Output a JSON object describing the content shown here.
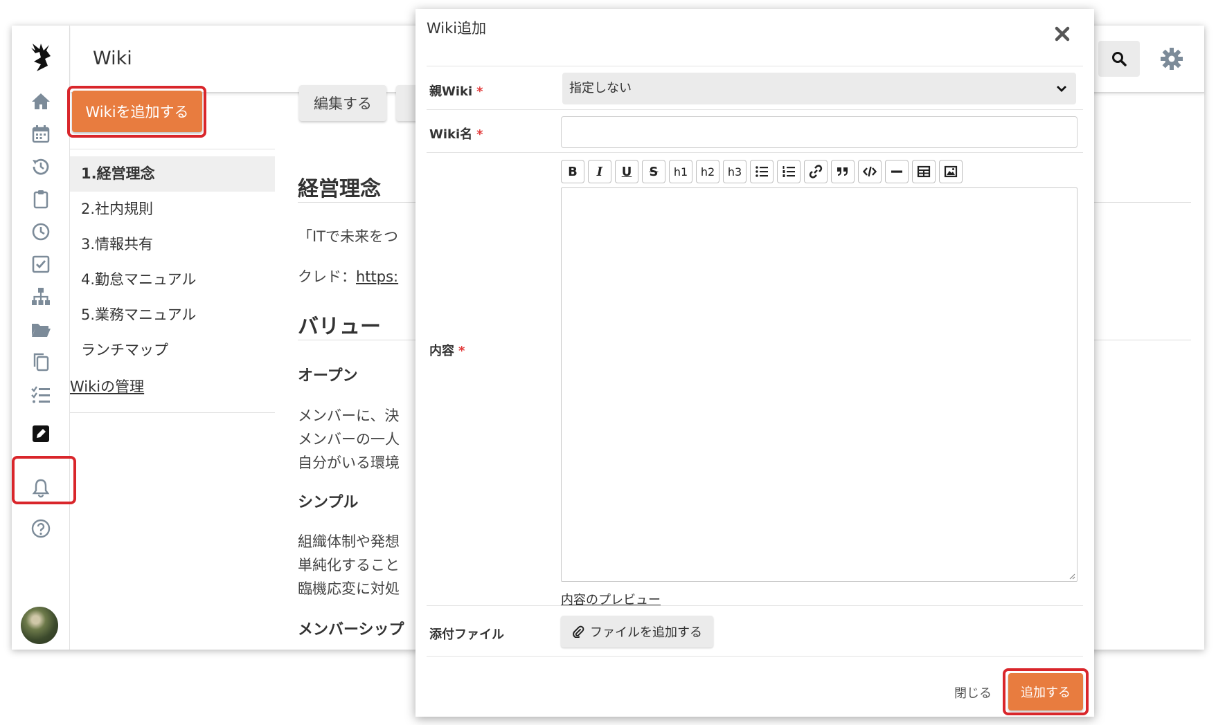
{
  "topbar": {
    "title": "Wiki",
    "search_icon": "search-icon",
    "settings_icon": "gear-icon"
  },
  "sidebar": {
    "items": [
      {
        "name": "home-icon"
      },
      {
        "name": "calendar-icon"
      },
      {
        "name": "history-icon"
      },
      {
        "name": "clipboard-icon"
      },
      {
        "name": "clock-icon"
      },
      {
        "name": "checkbox-icon"
      },
      {
        "name": "org-chart-icon"
      },
      {
        "name": "folder-open-icon"
      },
      {
        "name": "copy-icon"
      },
      {
        "name": "checklist-icon"
      },
      {
        "name": "edit-square-icon",
        "active": true
      },
      {
        "name": "bell-icon"
      },
      {
        "name": "help-circle-icon"
      }
    ]
  },
  "left_panel": {
    "add_wiki_label": "Wikiを追加する",
    "nav": [
      {
        "label": "1.経営理念",
        "active": true
      },
      {
        "label": "2.社内規則"
      },
      {
        "label": "3.情報共有"
      },
      {
        "label": "4.勤怠マニュアル"
      },
      {
        "label": "5.業務マニュアル"
      },
      {
        "label": "ランチマップ"
      }
    ],
    "manage_label": "Wikiの管理"
  },
  "content": {
    "edit_label": "編集する",
    "heading": "経営理念",
    "line1": "「ITで未来をつ",
    "credit_prefix": "クレド：",
    "credit_link": "https:",
    "values_heading": "バリュー",
    "open_heading": "オープン",
    "open_lines": [
      "メンバーに、決",
      "メンバーの一人",
      "自分がいる環境"
    ],
    "simple_heading": "シンプル",
    "simple_lines": [
      "組織体制や発想",
      "単純化すること",
      "臨機応変に対処"
    ],
    "member_heading": "メンバーシップ"
  },
  "modal": {
    "title": "Wiki追加",
    "parent_label": "親Wiki",
    "parent_value": "指定しない",
    "name_label": "Wiki名",
    "name_value": "",
    "body_label": "内容",
    "required_mark": "*",
    "toolbar": [
      "B",
      "I",
      "U",
      "S",
      "h1",
      "h2",
      "h3",
      "ul",
      "ol",
      "link",
      "quote",
      "code",
      "hr",
      "table",
      "image"
    ],
    "preview_label": "内容のプレビュー",
    "attach_label": "添付ファイル",
    "attach_button": "ファイルを追加する",
    "close_label": "閉じる",
    "submit_label": "追加する"
  },
  "colors": {
    "accent": "#e87c3f",
    "highlight": "#d9262b"
  }
}
